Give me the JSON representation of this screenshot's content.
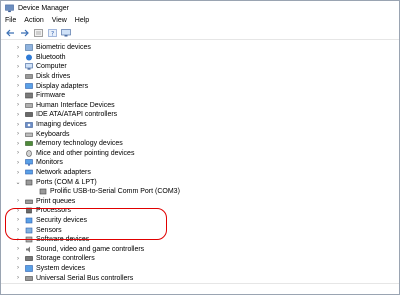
{
  "window": {
    "title": "Device Manager"
  },
  "menu": {
    "file": "File",
    "action": "Action",
    "view": "View",
    "help": "Help"
  },
  "tree": {
    "items": [
      "Biometric devices",
      "Bluetooth",
      "Computer",
      "Disk drives",
      "Display adapters",
      "Firmware",
      "Human Interface Devices",
      "IDE ATA/ATAPI controllers",
      "Imaging devices",
      "Keyboards",
      "Memory technology devices",
      "Mice and other pointing devices",
      "Monitors",
      "Network adapters",
      "Ports (COM & LPT)",
      "Prolific USB-to-Serial Comm Port (COM3)",
      "Print queues",
      "Processors",
      "Security devices",
      "Sensors",
      "Software devices",
      "Sound, video and game controllers",
      "Storage controllers",
      "System devices",
      "Universal Serial Bus controllers"
    ]
  },
  "colors": {
    "highlight": "#e00000",
    "icon_blue": "#2f7bd6"
  }
}
